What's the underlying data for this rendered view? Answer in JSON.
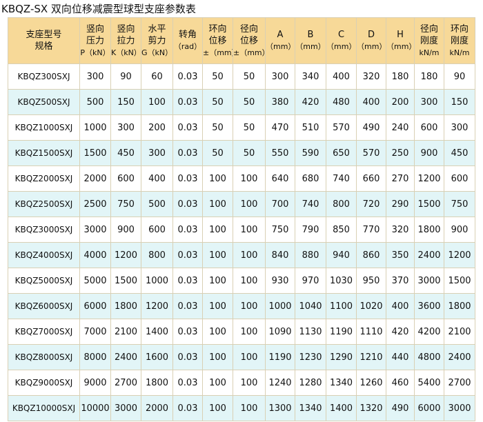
{
  "title": "KBQZ-SX 双向位移减震型球型支座参数表",
  "headers": [
    {
      "l1": "支座型号",
      "l2": "规格"
    },
    {
      "l1": "竖向",
      "l2": "压力",
      "l3": "P（kN）"
    },
    {
      "l1": "竖向",
      "l2": "拉力",
      "l3": "K（kN）"
    },
    {
      "l1": "水平",
      "l2": "剪力",
      "l3": "G（kN）"
    },
    {
      "l1": "转角",
      "l2": "（rad）"
    },
    {
      "l1": "环向",
      "l2": "位移",
      "l3": "±（mm）"
    },
    {
      "l1": "径向",
      "l2": "位移",
      "l3": "±（mm）"
    },
    {
      "l1": "A",
      "l2": "（mm）"
    },
    {
      "l1": "B",
      "l2": "（mm）"
    },
    {
      "l1": "C",
      "l2": "（mm）"
    },
    {
      "l1": "D",
      "l2": "（mm）"
    },
    {
      "l1": "H",
      "l2": "（mm）"
    },
    {
      "l1": "径向",
      "l2": "刚度",
      "l3": "kN/m"
    },
    {
      "l1": "环向",
      "l2": "刚度",
      "l3": "kN/m"
    }
  ],
  "rows": [
    [
      "KBQZ300SXJ",
      "300",
      "90",
      "60",
      "0.03",
      "50",
      "50",
      "300",
      "340",
      "400",
      "320",
      "180",
      "180",
      "90"
    ],
    [
      "KBQZ500SXJ",
      "500",
      "150",
      "100",
      "0.03",
      "50",
      "50",
      "380",
      "420",
      "480",
      "400",
      "200",
      "300",
      "150"
    ],
    [
      "KBQZ1000SXJ",
      "1000",
      "300",
      "200",
      "0.03",
      "50",
      "50",
      "470",
      "510",
      "570",
      "490",
      "240",
      "600",
      "300"
    ],
    [
      "KBQZ1500SXJ",
      "1500",
      "450",
      "300",
      "0.03",
      "50",
      "50",
      "550",
      "590",
      "650",
      "570",
      "250",
      "900",
      "450"
    ],
    [
      "KBQZ2000SXJ",
      "2000",
      "600",
      "400",
      "0.03",
      "100",
      "100",
      "640",
      "680",
      "740",
      "660",
      "270",
      "1200",
      "600"
    ],
    [
      "KBQZ2500SXJ",
      "2500",
      "750",
      "500",
      "0.03",
      "100",
      "100",
      "700",
      "740",
      "800",
      "720",
      "290",
      "1500",
      "750"
    ],
    [
      "KBQZ3000SXJ",
      "3000",
      "900",
      "600",
      "0.03",
      "100",
      "100",
      "750",
      "790",
      "850",
      "770",
      "320",
      "1800",
      "900"
    ],
    [
      "KBQZ4000SXJ",
      "4000",
      "1200",
      "800",
      "0.03",
      "100",
      "100",
      "840",
      "880",
      "940",
      "860",
      "350",
      "2400",
      "1200"
    ],
    [
      "KBQZ5000SXJ",
      "5000",
      "1500",
      "1000",
      "0.03",
      "100",
      "100",
      "930",
      "970",
      "1030",
      "950",
      "370",
      "3000",
      "1500"
    ],
    [
      "KBQZ6000SXJ",
      "6000",
      "1800",
      "1200",
      "0.03",
      "100",
      "100",
      "1000",
      "1040",
      "1100",
      "1020",
      "400",
      "3600",
      "1800"
    ],
    [
      "KBQZ7000SXJ",
      "7000",
      "2100",
      "1400",
      "0.03",
      "100",
      "100",
      "1090",
      "1130",
      "1190",
      "1110",
      "420",
      "4200",
      "2100"
    ],
    [
      "KBQZ8000SXJ",
      "8000",
      "2400",
      "1600",
      "0.03",
      "100",
      "100",
      "1190",
      "1230",
      "1290",
      "1210",
      "440",
      "4800",
      "2400"
    ],
    [
      "KBQZ9000SXJ",
      "9000",
      "2700",
      "1800",
      "0.03",
      "100",
      "100",
      "1240",
      "1280",
      "1340",
      "1260",
      "460",
      "5400",
      "2700"
    ],
    [
      "KBQZ10000SXJ",
      "10000",
      "3000",
      "2000",
      "0.03",
      "100",
      "100",
      "1300",
      "1340",
      "1400",
      "1320",
      "490",
      "6000",
      "3000"
    ]
  ]
}
